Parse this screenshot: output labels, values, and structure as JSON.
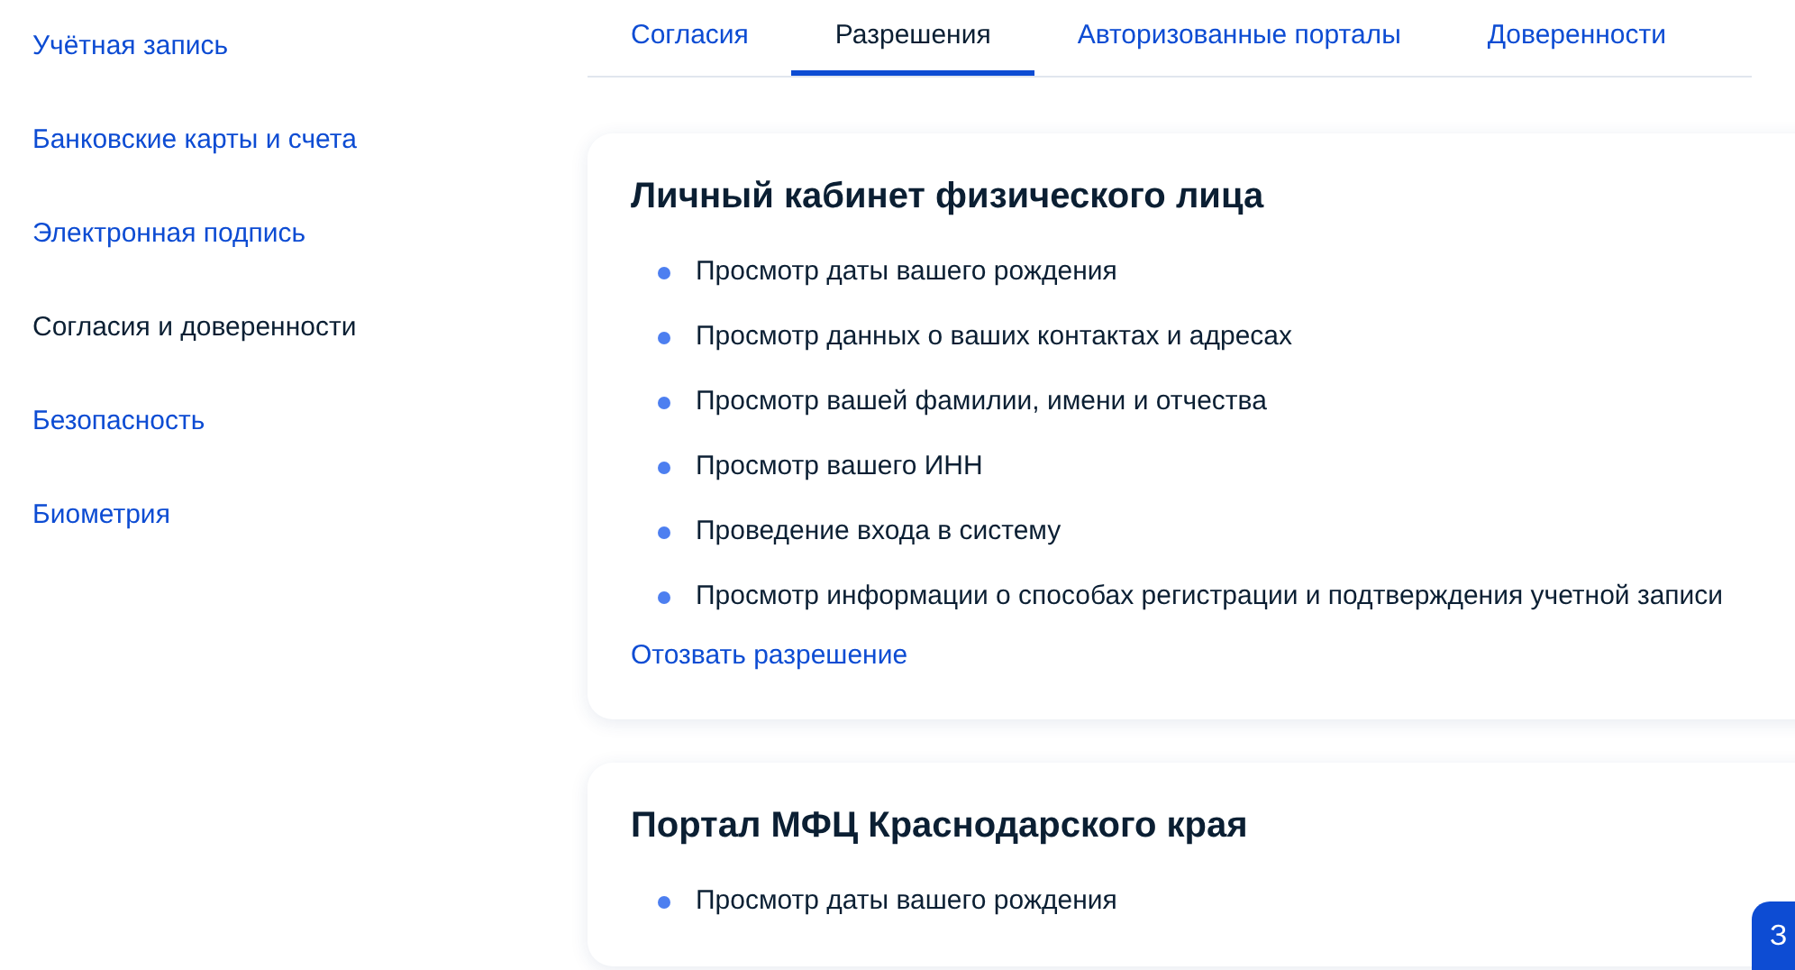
{
  "sidebar": {
    "items": [
      {
        "label": "Учётная запись",
        "selected": false
      },
      {
        "label": "Банковские карты и счета",
        "selected": false
      },
      {
        "label": "Электронная подпись",
        "selected": false
      },
      {
        "label": "Согласия и доверенности",
        "selected": true
      },
      {
        "label": "Безопасность",
        "selected": false
      },
      {
        "label": "Биометрия",
        "selected": false
      }
    ]
  },
  "tabs": [
    {
      "label": "Согласия",
      "selected": false
    },
    {
      "label": "Разрешения",
      "selected": true
    },
    {
      "label": "Авторизованные порталы",
      "selected": false
    },
    {
      "label": "Доверенности",
      "selected": false
    }
  ],
  "cards": [
    {
      "title": "Личный кабинет физического лица",
      "permissions": [
        "Просмотр даты вашего рождения",
        "Просмотр данных о ваших контактах и адресах",
        "Просмотр вашей фамилии, имени и отчества",
        "Просмотр вашего ИНН",
        "Проведение входа в систему",
        "Просмотр информации о способах регистрации и подтверждения учетной записи"
      ],
      "revoke_link": "Отозвать разрешение"
    },
    {
      "title": "Портал МФЦ Краснодарского края",
      "permissions": [
        "Просмотр даты вашего рождения"
      ]
    }
  ],
  "floating_button": {
    "label": "З"
  }
}
